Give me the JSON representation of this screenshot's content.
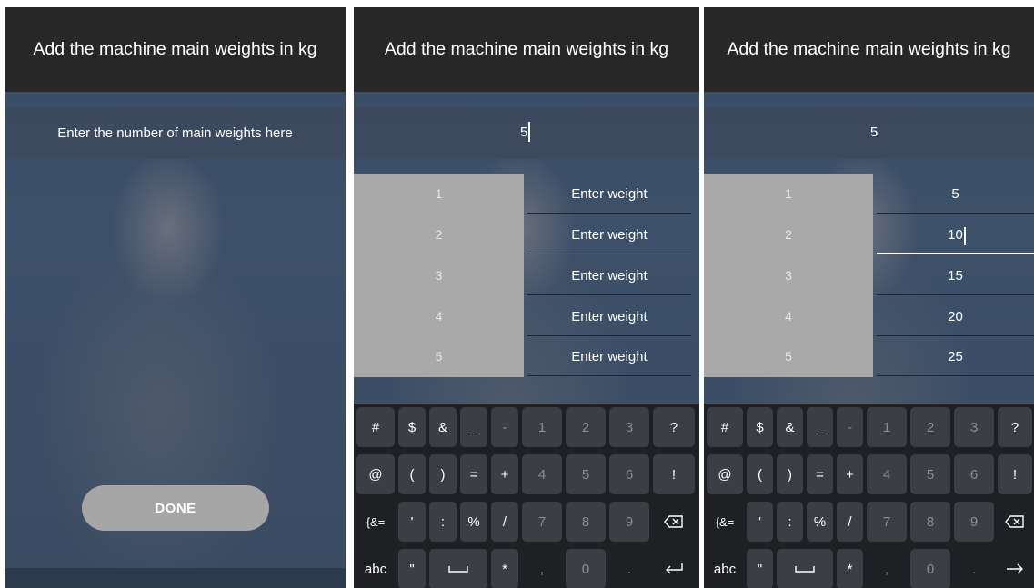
{
  "screens": [
    {
      "title": "Add the machine main weights in kg",
      "count_placeholder": "Enter the number of main weights here",
      "done_label": "DONE"
    },
    {
      "title": "Add the machine main weights in kg",
      "count_value": "5",
      "indices": [
        "1",
        "2",
        "3",
        "4",
        "5"
      ],
      "weight_placeholder": "Enter weight",
      "weights": [
        "",
        "",
        "",
        "",
        ""
      ]
    },
    {
      "title": "Add the machine main weights in kg",
      "count_value": "5",
      "indices": [
        "1",
        "2",
        "3",
        "4",
        "5"
      ],
      "weights": [
        "5",
        "10",
        "15",
        "20",
        "25"
      ]
    }
  ],
  "keyboard_rows": [
    [
      "#",
      "$",
      "&",
      "_",
      "-",
      "1",
      "2",
      "3",
      "?"
    ],
    [
      "@",
      "(",
      ")",
      "=",
      "+",
      "4",
      "5",
      "6",
      "!"
    ],
    [
      "{&=",
      "'",
      ":",
      "%",
      "/",
      "7",
      "8",
      "9",
      "⌫"
    ],
    [
      "abc",
      "\"",
      "␣",
      "*",
      ",",
      "0",
      ".",
      "enter"
    ]
  ],
  "keyboard_icons": {
    "space": "space-icon",
    "backspace": "backspace-icon",
    "enter_screen2": "enter-return-icon",
    "enter_screen3": "next-arrow-icon"
  },
  "colors": {
    "title_bar": "#272727",
    "index_panel": "#a9a9a9",
    "done_button": "#a6a6a6",
    "keyboard": "#1e2024",
    "key": "#3b3e44"
  }
}
